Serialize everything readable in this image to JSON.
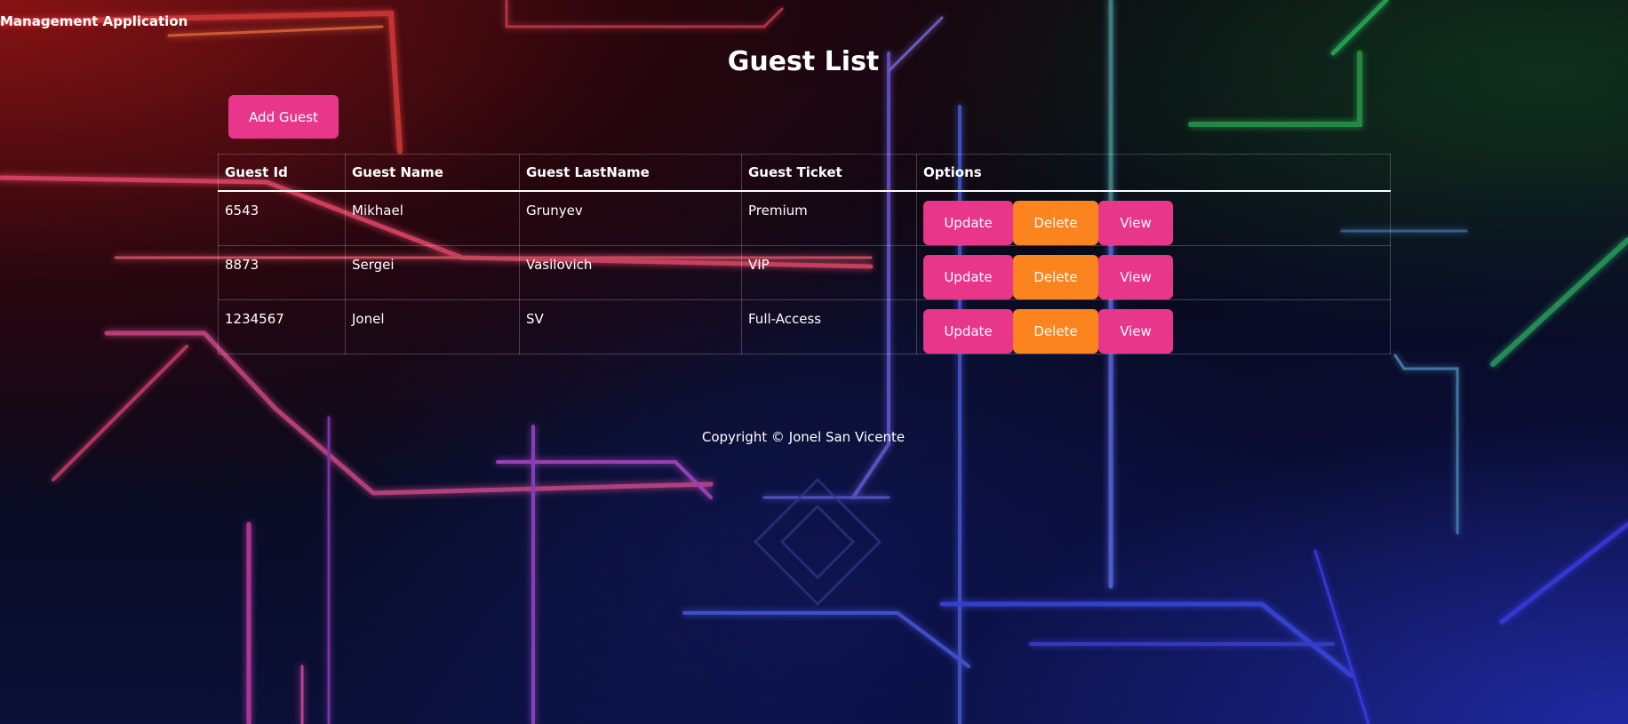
{
  "app": {
    "brand": "Management Application"
  },
  "page": {
    "title": "Guest List",
    "add_button_label": "Add Guest"
  },
  "table": {
    "headers": [
      "Guest Id",
      "Guest Name",
      "Guest LastName",
      "Guest Ticket",
      "Options"
    ],
    "rows": [
      {
        "id": "6543",
        "name": "Mikhael",
        "lastname": "Grunyev",
        "ticket": "Premium"
      },
      {
        "id": "8873",
        "name": "Sergei",
        "lastname": "Vasilovich",
        "ticket": "VIP"
      },
      {
        "id": "1234567",
        "name": "Jonel",
        "lastname": "SV",
        "ticket": "Full-Access"
      }
    ],
    "actions": {
      "update_label": "Update",
      "delete_label": "Delete",
      "view_label": "View"
    }
  },
  "footer": {
    "text": "Copyright © Jonel San Vicente"
  },
  "colors": {
    "primary": "#e8368a",
    "danger": "#fb841f"
  }
}
